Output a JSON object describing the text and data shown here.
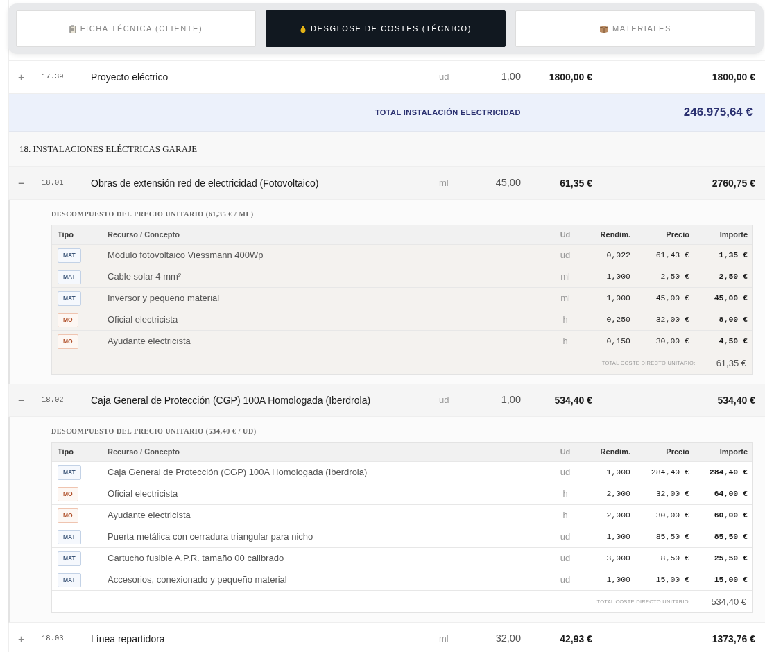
{
  "tabs": [
    {
      "label": "FICHA TÉCNICA (CLIENTE)",
      "selected": false
    },
    {
      "label": "DESGLOSE DE COSTES (TÉCNICO)",
      "selected": true
    },
    {
      "label": "MATERIALES",
      "selected": false
    }
  ],
  "rows": [
    {
      "kind": "gap"
    },
    {
      "kind": "item",
      "toggle": "+",
      "code": "17.39",
      "description": "Proyecto eléctrico",
      "unit": "ud",
      "quantity": "1,00",
      "price": "1800,00 €",
      "amount": "1800,00 €",
      "expanded": false
    },
    {
      "kind": "total",
      "label": "TOTAL INSTALACIÓN ELECTRICIDAD",
      "value": "246.975,64 €"
    },
    {
      "kind": "heading",
      "label": "18. INSTALACIONES ELÉCTRICAS GARAJE"
    },
    {
      "kind": "item",
      "toggle": "−",
      "code": "18.01",
      "description": "Obras de extensión red de electricidad (Fotovoltaico)",
      "unit": "ml",
      "quantity": "45,00",
      "price": "61,35 €",
      "amount": "2760,75 €",
      "expanded": true,
      "breakdown": {
        "title": "DESCOMPUESTO DEL PRECIO UNITARIO (61,35 € / ML)",
        "highlighted": true,
        "columns": [
          "Tipo",
          "Recurso / Concepto",
          "Ud",
          "Rendim.",
          "Precio",
          "Importe"
        ],
        "lines": [
          {
            "kind": "mat",
            "tag": "MAT",
            "concept": "Módulo fotovoltaico Viessmann 400Wp",
            "unit": "ud",
            "yield": "0,022",
            "price": "61,43 €",
            "amount": "1,35 €"
          },
          {
            "kind": "mat",
            "tag": "MAT",
            "concept": "Cable solar 4 mm²",
            "unit": "ml",
            "yield": "1,000",
            "price": "2,50 €",
            "amount": "2,50 €"
          },
          {
            "kind": "mat",
            "tag": "MAT",
            "concept": "Inversor y pequeño material",
            "unit": "ml",
            "yield": "1,000",
            "price": "45,00 €",
            "amount": "45,00 €"
          },
          {
            "kind": "mo",
            "tag": "MO",
            "concept": "Oficial electricista",
            "unit": "h",
            "yield": "0,250",
            "price": "32,00 €",
            "amount": "8,00 €"
          },
          {
            "kind": "mo",
            "tag": "MO",
            "concept": "Ayudante electricista",
            "unit": "h",
            "yield": "0,150",
            "price": "30,00 €",
            "amount": "4,50 €"
          }
        ],
        "total_label": "TOTAL COSTE DIRECTO UNITARIO:",
        "total": "61,35 €"
      }
    },
    {
      "kind": "item",
      "toggle": "−",
      "code": "18.02",
      "description": "Caja General de Protección (CGP) 100A Homologada (Iberdrola)",
      "unit": "ud",
      "quantity": "1,00",
      "price": "534,40 €",
      "amount": "534,40 €",
      "expanded": true,
      "breakdown": {
        "title": "DESCOMPUESTO DEL PRECIO UNITARIO (534,40 € / UD)",
        "highlighted": false,
        "columns": [
          "Tipo",
          "Recurso / Concepto",
          "Ud",
          "Rendim.",
          "Precio",
          "Importe"
        ],
        "lines": [
          {
            "kind": "mat",
            "tag": "MAT",
            "concept": "Caja General de Protección (CGP) 100A Homologada (Iberdrola)",
            "unit": "ud",
            "yield": "1,000",
            "price": "284,40 €",
            "amount": "284,40 €"
          },
          {
            "kind": "mo",
            "tag": "MO",
            "concept": "Oficial electricista",
            "unit": "h",
            "yield": "2,000",
            "price": "32,00 €",
            "amount": "64,00 €"
          },
          {
            "kind": "mo",
            "tag": "MO",
            "concept": "Ayudante electricista",
            "unit": "h",
            "yield": "2,000",
            "price": "30,00 €",
            "amount": "60,00 €"
          },
          {
            "kind": "mat",
            "tag": "MAT",
            "concept": "Puerta metálica con cerradura triangular para nicho",
            "unit": "ud",
            "yield": "1,000",
            "price": "85,50 €",
            "amount": "85,50 €"
          },
          {
            "kind": "mat",
            "tag": "MAT",
            "concept": "Cartucho fusible A.P.R. tamaño 00 calibrado",
            "unit": "ud",
            "yield": "3,000",
            "price": "8,50 €",
            "amount": "25,50 €"
          },
          {
            "kind": "mat",
            "tag": "MAT",
            "concept": "Accesorios, conexionado y pequeño material",
            "unit": "ud",
            "yield": "1,000",
            "price": "15,00 €",
            "amount": "15,00 €"
          }
        ],
        "total_label": "TOTAL COSTE DIRECTO UNITARIO:",
        "total": "534,40 €"
      }
    },
    {
      "kind": "item",
      "toggle": "+",
      "code": "18.03",
      "description": "Línea repartidora",
      "unit": "ml",
      "quantity": "32,00",
      "price": "42,93 €",
      "amount": "1373,76 €",
      "expanded": false
    }
  ]
}
